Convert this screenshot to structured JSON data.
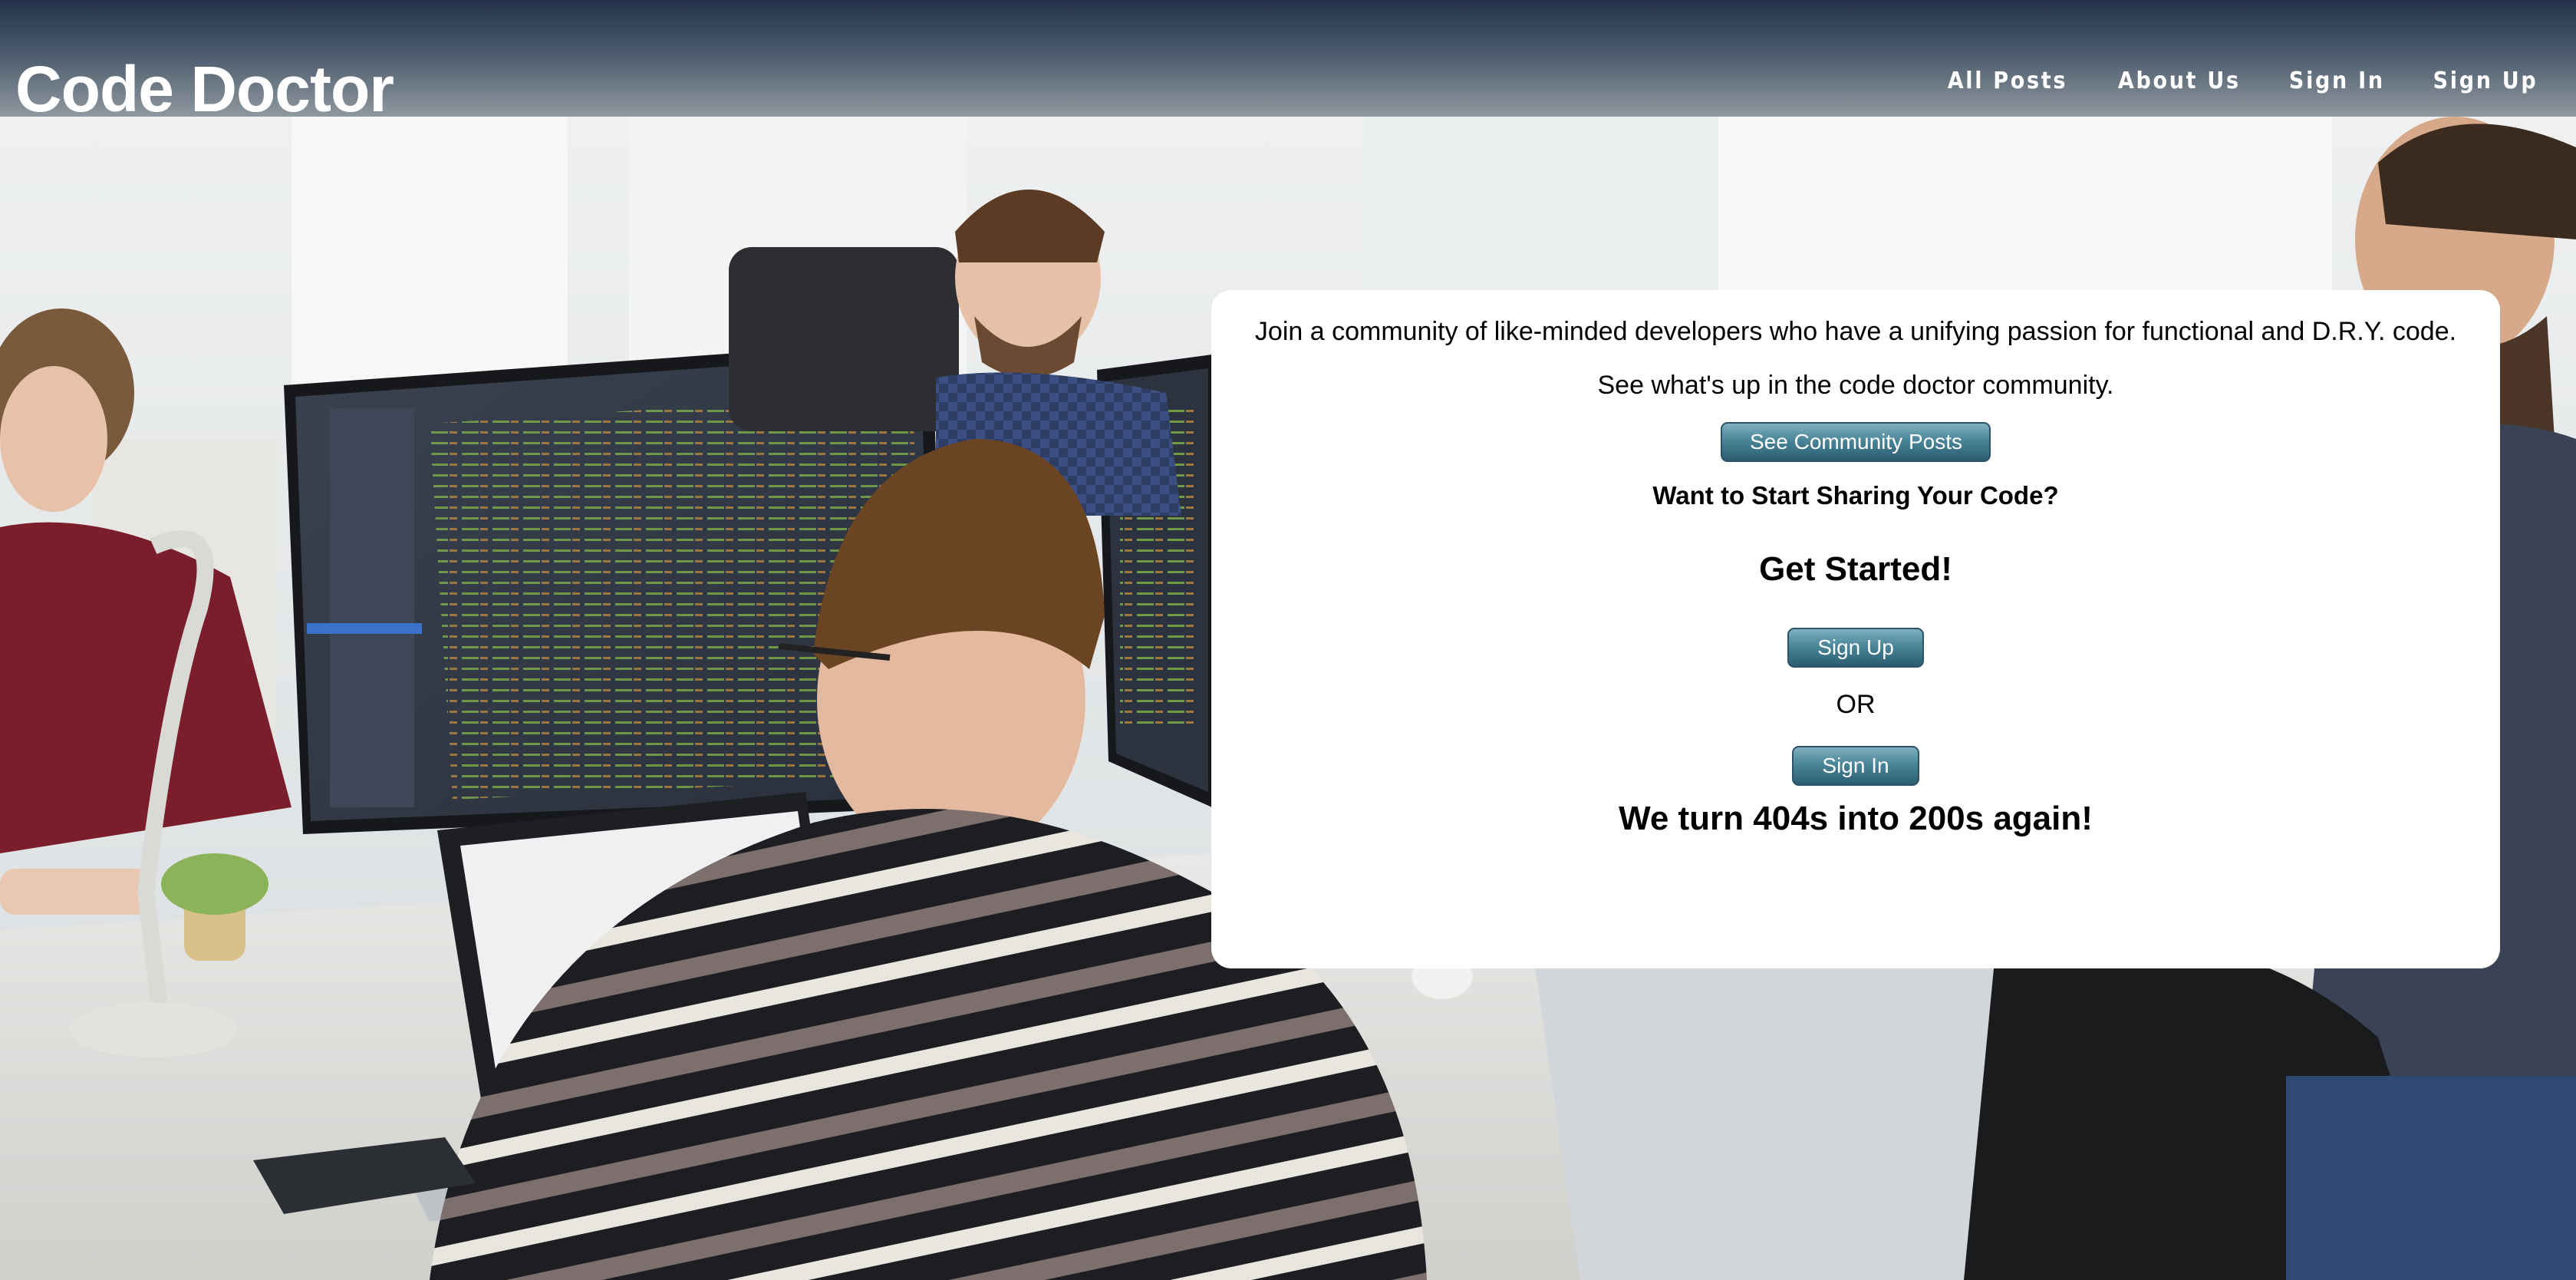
{
  "header": {
    "brand": "Code Doctor",
    "nav": [
      {
        "label": "All Posts"
      },
      {
        "label": "About Us"
      },
      {
        "label": "Sign In"
      },
      {
        "label": "Sign Up"
      }
    ]
  },
  "hero": {
    "intro": "Join a community of like-minded developers who have a unifying passion for functional and D.R.Y. code.",
    "see_whats_up": "See what's up in the code doctor community.",
    "community_button": "See Community Posts",
    "want_sharing": "Want to Start Sharing Your Code?",
    "get_started": "Get Started!",
    "signup_button": "Sign Up",
    "or_text": "OR",
    "signin_button": "Sign In",
    "tagline": "We turn 404s into 200s again!"
  },
  "colors": {
    "header_top": "#23324a",
    "header_bottom": "#8f989f",
    "button": "#4a8698",
    "card": "#ffffff"
  },
  "background": {
    "description_icon": "office-developers-photo"
  }
}
